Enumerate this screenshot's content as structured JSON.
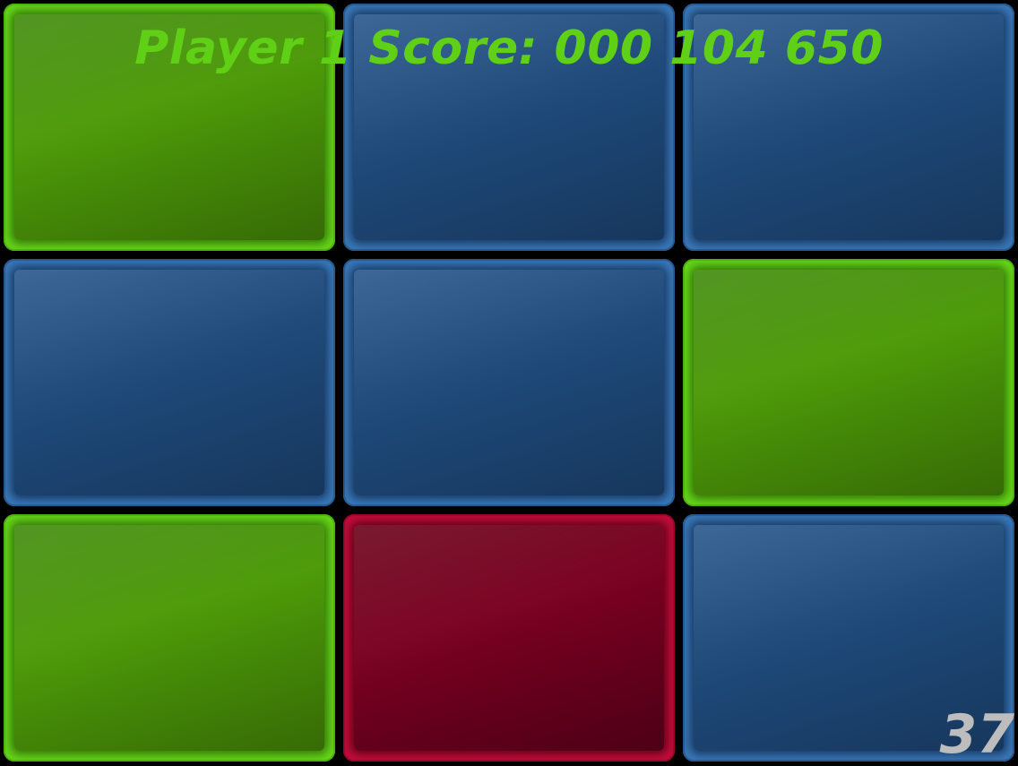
{
  "hud": {
    "score_text": "Player 1 Score: 000 104 650",
    "timer": "37"
  },
  "colors": {
    "blue": "#3a78b8",
    "green": "#66d61a",
    "red": "#c40c3c",
    "score_text": "#5fd016",
    "timer_text": "#bdbdbd",
    "background": "#000000"
  },
  "board": {
    "rows": 3,
    "cols": 3,
    "tiles": [
      [
        "green",
        "blue",
        "blue"
      ],
      [
        "blue",
        "blue",
        "green"
      ],
      [
        "green",
        "red",
        "blue"
      ]
    ]
  }
}
